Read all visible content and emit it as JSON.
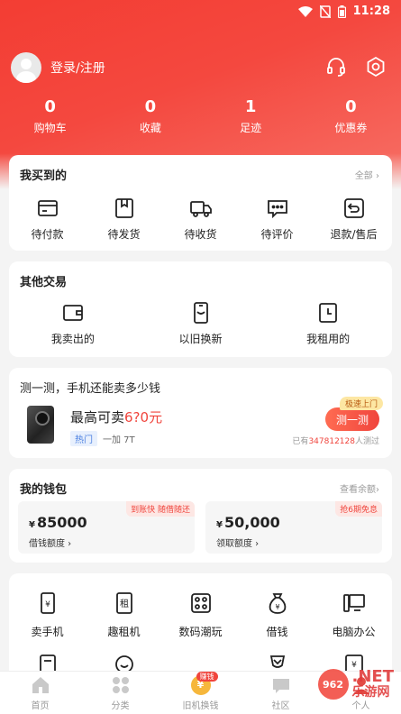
{
  "status_bar": {
    "time": "11:28"
  },
  "profile": {
    "login_label": "登录/注册",
    "icons": [
      "headset-icon",
      "settings-icon"
    ]
  },
  "stats": [
    {
      "value": "0",
      "label": "购物车"
    },
    {
      "value": "0",
      "label": "收藏"
    },
    {
      "value": "1",
      "label": "足迹"
    },
    {
      "value": "0",
      "label": "优惠券"
    }
  ],
  "purchases": {
    "title": "我买到的",
    "more": "全部 ›",
    "items": [
      {
        "icon": "card-icon",
        "label": "待付款"
      },
      {
        "icon": "box-icon",
        "label": "待发货"
      },
      {
        "icon": "truck-icon",
        "label": "待收货"
      },
      {
        "icon": "comment-icon",
        "label": "待评价"
      },
      {
        "icon": "return-icon",
        "label": "退款/售后"
      }
    ]
  },
  "other": {
    "title": "其他交易",
    "items": [
      {
        "icon": "wallet-icon",
        "label": "我卖出的"
      },
      {
        "icon": "phone-swap-icon",
        "label": "以旧换新"
      },
      {
        "icon": "clock-icon",
        "label": "我租用的"
      }
    ]
  },
  "evaluate": {
    "title": "测一测，手机还能卖多少钱",
    "price_prefix": "最高可卖",
    "price": "6?0元",
    "hot_tag": "热门",
    "model": "一加 7T",
    "button": "测一测",
    "fast_tag": "极速上门",
    "tested_prefix": "已有",
    "tested_count": "347812128",
    "tested_suffix": "人测过"
  },
  "wallet": {
    "title": "我的钱包",
    "more": "查看余额›",
    "boxes": [
      {
        "currency": "¥",
        "amount": "85000",
        "label": "借钱额度 ›",
        "tag": "到账快 随借随还"
      },
      {
        "currency": "¥",
        "amount": "50,000",
        "label": "领取额度 ›",
        "tag": "抢6期免息"
      }
    ]
  },
  "services": {
    "row1": [
      {
        "icon": "sell-phone-icon",
        "label": "卖手机"
      },
      {
        "icon": "rent-icon",
        "label": "趣租机"
      },
      {
        "icon": "digital-icon",
        "label": "数码潮玩"
      },
      {
        "icon": "money-bag-icon",
        "label": "借钱"
      },
      {
        "icon": "computer-icon",
        "label": "电脑办公"
      }
    ],
    "row2": [
      {
        "icon": "document-icon"
      },
      {
        "icon": "smile-icon"
      },
      {
        "icon": "blank"
      },
      {
        "icon": "trophy-icon"
      },
      {
        "icon": "yen-doc-icon"
      }
    ]
  },
  "tabbar": {
    "tabs": [
      {
        "icon": "home-icon",
        "label": "首页"
      },
      {
        "icon": "category-icon",
        "label": "分类"
      },
      {
        "icon": "coin-icon",
        "label": "旧机换钱",
        "badge": "赚钱",
        "coin": "¥"
      },
      {
        "icon": "community-icon",
        "label": "社区"
      },
      {
        "icon": "person-icon",
        "label": "个人"
      }
    ]
  },
  "watermark": {
    "circle": "962",
    "main": ".NET",
    "sub": "乐游网"
  }
}
